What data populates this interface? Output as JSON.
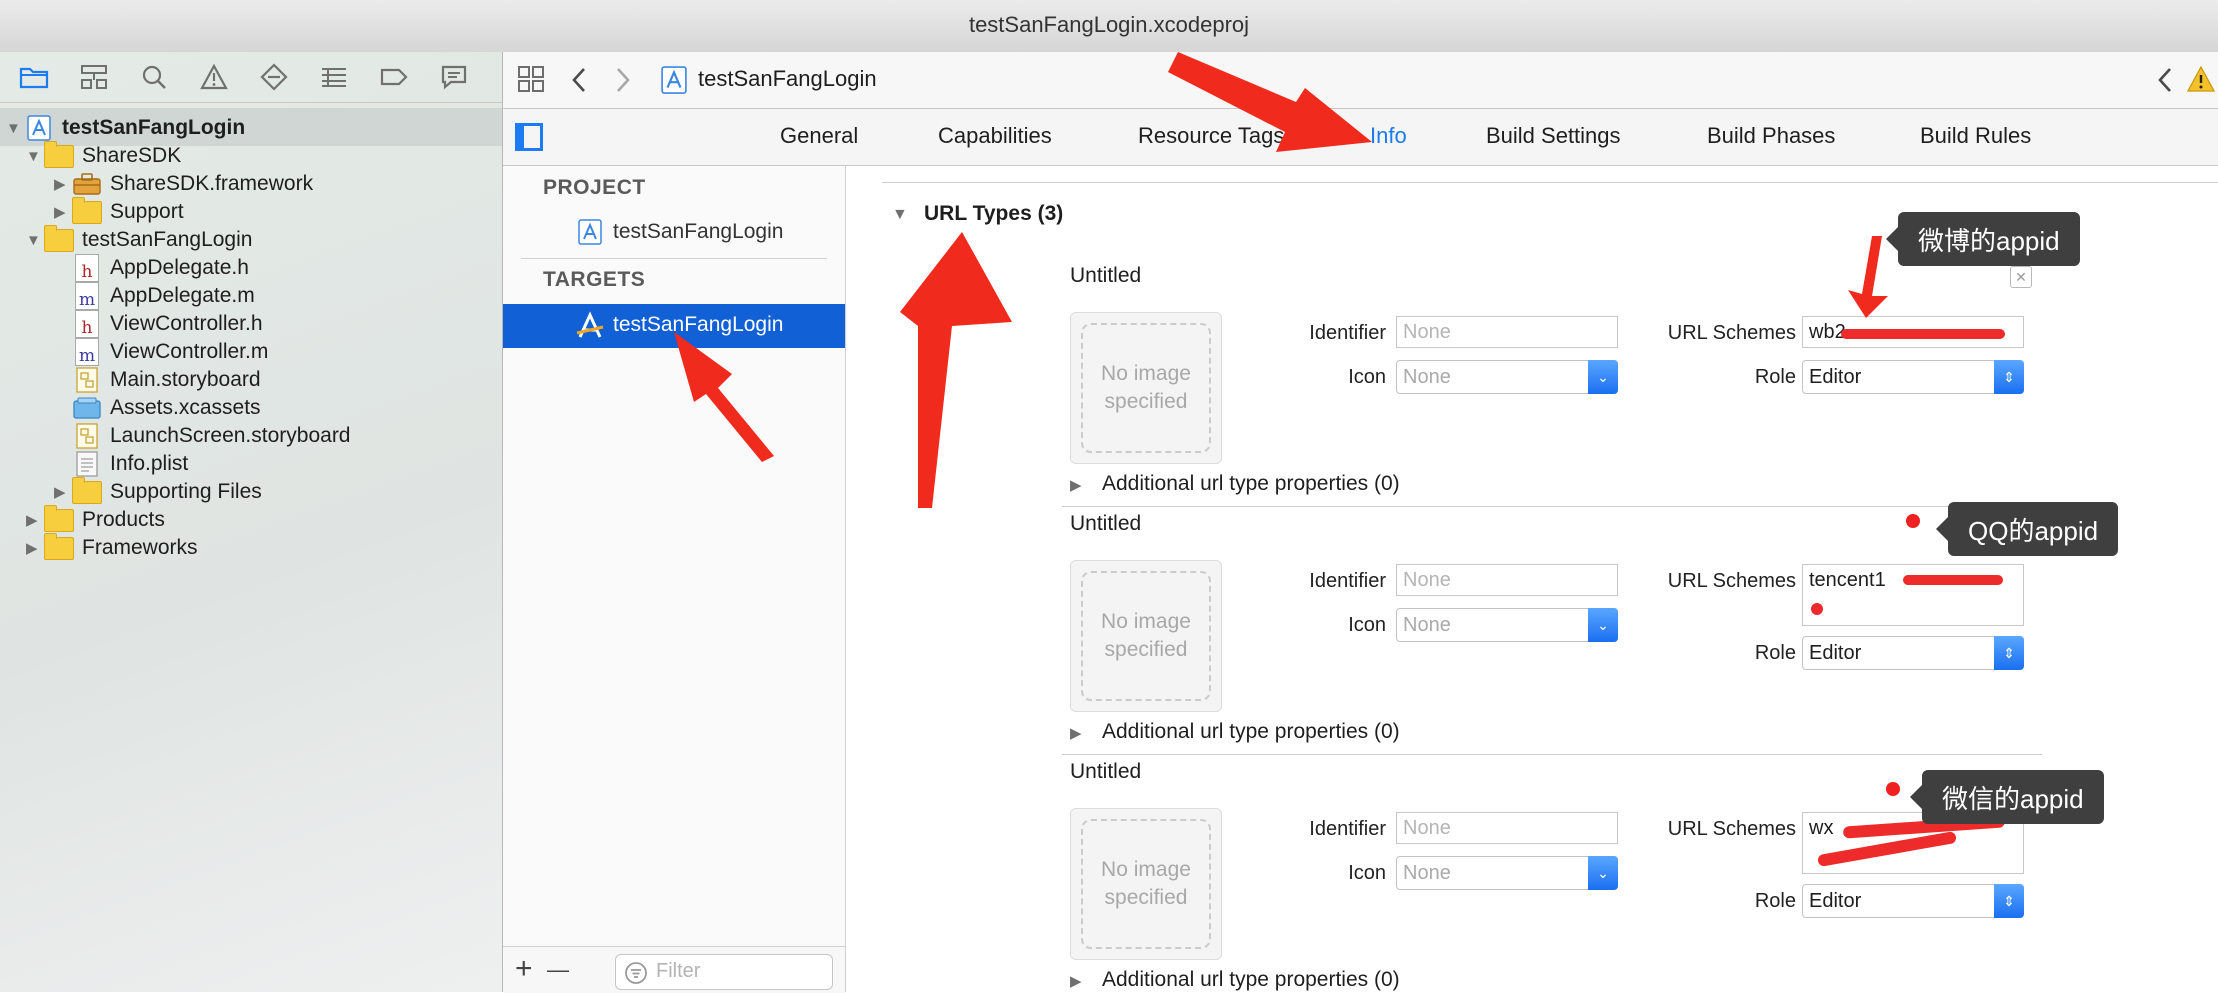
{
  "window": {
    "title": "testSanFangLogin.xcodeproj"
  },
  "navigator": {
    "toolbar_icons": [
      "folder-icon",
      "hierarchy-icon",
      "search-icon",
      "warning-icon",
      "breakpoint-diamond-icon",
      "list-icon",
      "tag-icon",
      "message-icon"
    ],
    "tree": [
      {
        "label": "testSanFangLogin",
        "type": "project",
        "expanded": true
      },
      {
        "label": "ShareSDK",
        "type": "folder",
        "expanded": true
      },
      {
        "label": "ShareSDK.framework",
        "type": "framework",
        "expanded": false
      },
      {
        "label": "Support",
        "type": "folder",
        "expanded": false
      },
      {
        "label": "testSanFangLogin",
        "type": "folder",
        "expanded": true
      },
      {
        "label": "AppDelegate.h",
        "type": "file",
        "glyph": "h"
      },
      {
        "label": "AppDelegate.m",
        "type": "file",
        "glyph": "m"
      },
      {
        "label": "ViewController.h",
        "type": "file",
        "glyph": "h"
      },
      {
        "label": "ViewController.m",
        "type": "file",
        "glyph": "m"
      },
      {
        "label": "Main.storyboard",
        "type": "storyboard"
      },
      {
        "label": "Assets.xcassets",
        "type": "assets"
      },
      {
        "label": "LaunchScreen.storyboard",
        "type": "storyboard"
      },
      {
        "label": "Info.plist",
        "type": "plist"
      },
      {
        "label": "Supporting Files",
        "type": "folder",
        "expanded": false
      },
      {
        "label": "Products",
        "type": "folder",
        "expanded": false
      },
      {
        "label": "Frameworks",
        "type": "folder",
        "expanded": false
      }
    ]
  },
  "jumpbar": {
    "breadcrumb": "testSanFangLogin"
  },
  "tabs": [
    "General",
    "Capabilities",
    "Resource Tags",
    "Info",
    "Build Settings",
    "Build Phases",
    "Build Rules"
  ],
  "active_tab": "Info",
  "targets_pane": {
    "project_header": "PROJECT",
    "project_item": "testSanFangLogin",
    "targets_header": "TARGETS",
    "target_item": "testSanFangLogin",
    "filter_placeholder": "Filter",
    "add_label": "+",
    "remove_label": "—"
  },
  "url_types": {
    "header": "URL Types (3)",
    "labels": {
      "identifier": "Identifier",
      "icon": "Icon",
      "url_schemes": "URL Schemes",
      "role": "Role",
      "no_image": "No image specified"
    },
    "entries": [
      {
        "name": "Untitled",
        "identifier_placeholder": "None",
        "icon_placeholder": "None",
        "url_schemes": "wb2",
        "role": "Editor",
        "additional": "Additional url type properties (0)"
      },
      {
        "name": "Untitled",
        "identifier_placeholder": "None",
        "icon_placeholder": "None",
        "url_schemes": "tencent1",
        "role": "Editor",
        "additional": "Additional url type properties (0)"
      },
      {
        "name": "Untitled",
        "identifier_placeholder": "None",
        "icon_placeholder": "None",
        "url_schemes": "wx",
        "role": "Editor",
        "additional": "Additional url type properties (0)"
      }
    ]
  },
  "annotations": {
    "weibo": "微博的appid",
    "qq": "QQ的appid",
    "wechat": "微信的appid",
    "arrow_color": "#f02a1c"
  },
  "colors": {
    "accent": "#1a6ff0",
    "selection": "#1160d6",
    "tab_active": "#1a7cf2"
  }
}
